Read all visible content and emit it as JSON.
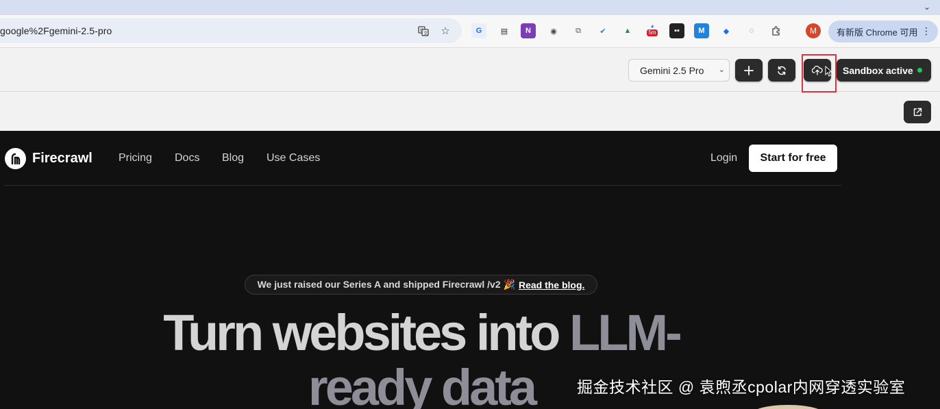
{
  "browser": {
    "url": "google%2Fgemini-2.5-pro",
    "update_label": "有新版 Chrome 可用",
    "profile_initial": "M",
    "badge_5m": "5m"
  },
  "appbar": {
    "model": "Gemini 2.5 Pro",
    "sandbox_label": "Sandbox active",
    "sandbox_status_color": "#22c55e"
  },
  "site": {
    "brand": "Firecrawl",
    "nav": [
      "Pricing",
      "Docs",
      "Blog",
      "Use Cases"
    ],
    "login": "Login",
    "cta": "Start for free",
    "announcement": "We just raised our Series A and shipped Firecrawl /v2 🎉",
    "announcement_link": "Read the blog.",
    "hero_line1_a": "Turn websites into",
    "hero_line1_b": "LLM-",
    "hero_line2": "ready data"
  },
  "watermark": "掘金技术社区 @ 袁煦丞cpolar内网穿透实验室"
}
